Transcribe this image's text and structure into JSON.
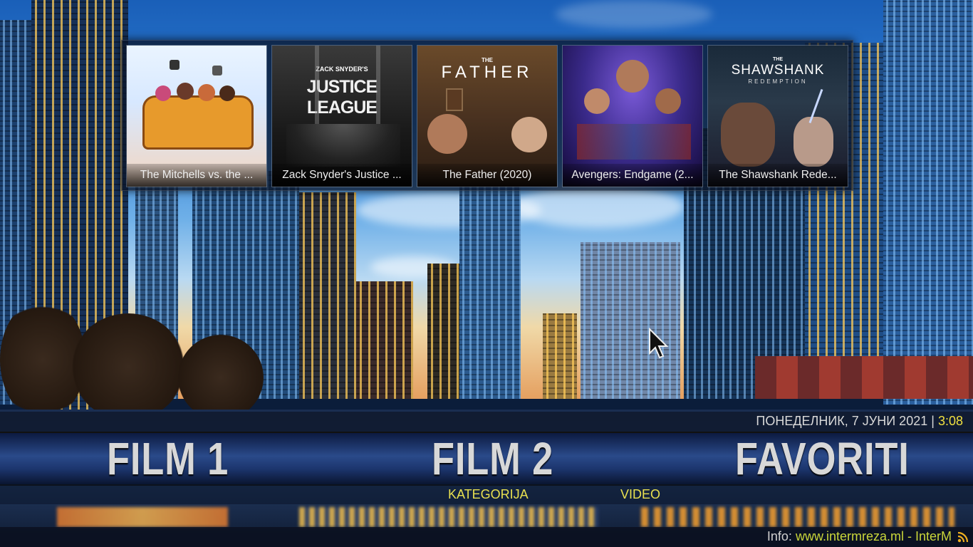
{
  "shelf": {
    "items": [
      {
        "title": "The Mitchells vs. the ...",
        "art_title": ""
      },
      {
        "title": "Zack Snyder's Justice ...",
        "art_pre": "ZACK SNYDER'S",
        "art_title": "JUSTICE LEAGUE"
      },
      {
        "title": "The Father (2020)",
        "art_pre": "THE",
        "art_title": "FATHER"
      },
      {
        "title": "Avengers: Endgame (2...",
        "art_title": ""
      },
      {
        "title": "The Shawshank Rede...",
        "art_pre": "THE",
        "art_title": "SHAWSHANK",
        "art_sub": "REDEMPTION"
      }
    ]
  },
  "status": {
    "date": "ПОНЕДЕЛНИК, 7 ЈУНИ 2021",
    "separator": "|",
    "time": "3:08"
  },
  "menu": {
    "items": [
      "FILM 1",
      "FILM 2",
      "FAVORITI"
    ],
    "subitems": [
      "KATEGORIJA",
      "VIDEO"
    ]
  },
  "ticker": {
    "label": "Info:",
    "text": "www.intermreza.ml - InterM"
  },
  "colors": {
    "accent_yellow": "#f0e040",
    "menu_text": "#d8d8d8",
    "ticker_green": "#c9d63a"
  },
  "icons": [
    "rss-icon",
    "mouse-pointer-icon"
  ]
}
